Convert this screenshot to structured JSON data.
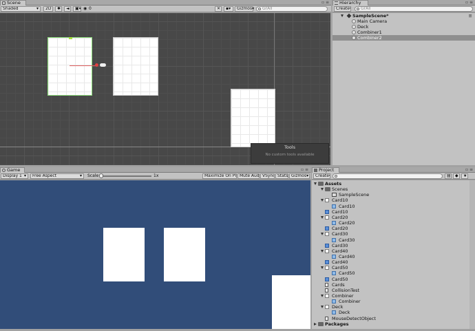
{
  "scene_panel": {
    "tab_label": "Scene",
    "toolbar": {
      "shading_mode": "Shaded",
      "mode_2d": "2D",
      "fx_count": "0",
      "gizmos_label": "Gizmos",
      "search_placeholder": "GrAll"
    },
    "tools_overlay": {
      "title": "Tools",
      "message": "No custom tools available"
    }
  },
  "hierarchy_panel": {
    "tab_label": "Hierarchy",
    "create_label": "Create",
    "search_placeholder": "GrAll",
    "scene_name": "SampleScene*",
    "items": [
      {
        "label": "Main Camera",
        "selected": false
      },
      {
        "label": "Deck",
        "selected": false
      },
      {
        "label": "Combiner1",
        "selected": false
      },
      {
        "label": "Combiner2",
        "selected": true
      }
    ]
  },
  "game_panel": {
    "tab_label": "Game",
    "display_label": "Display 1",
    "aspect_label": "Free Aspect",
    "scale_label": "Scale",
    "scale_value": "1x",
    "maximize_label": "Maximize On Play",
    "mute_label": "Mute Audio",
    "vsync_label": "VSync",
    "stats_label": "Stats",
    "gizmos_label": "Gizmos"
  },
  "project_panel": {
    "tab_label": "Project",
    "create_label": "Create",
    "items": [
      {
        "label": "Assets",
        "indent": 0,
        "icon": "folder",
        "arrow": "down",
        "bold": true
      },
      {
        "label": "Scenes",
        "indent": 1,
        "icon": "folder",
        "arrow": "down"
      },
      {
        "label": "SampleScene",
        "indent": 2,
        "icon": "scene"
      },
      {
        "label": "Card10",
        "indent": 1,
        "icon": "white",
        "arrow": "down"
      },
      {
        "label": "Card10",
        "indent": 2,
        "icon": "sub"
      },
      {
        "label": "Card10",
        "indent": 1,
        "icon": "prefab"
      },
      {
        "label": "Card20",
        "indent": 1,
        "icon": "white",
        "arrow": "down"
      },
      {
        "label": "Card20",
        "indent": 2,
        "icon": "sub"
      },
      {
        "label": "Card20",
        "indent": 1,
        "icon": "prefab"
      },
      {
        "label": "Card30",
        "indent": 1,
        "icon": "white",
        "arrow": "down"
      },
      {
        "label": "Card30",
        "indent": 2,
        "icon": "sub"
      },
      {
        "label": "Card30",
        "indent": 1,
        "icon": "prefab"
      },
      {
        "label": "Card40",
        "indent": 1,
        "icon": "white",
        "arrow": "down"
      },
      {
        "label": "Card40",
        "indent": 2,
        "icon": "sub"
      },
      {
        "label": "Card40",
        "indent": 1,
        "icon": "prefab"
      },
      {
        "label": "Card50",
        "indent": 1,
        "icon": "white",
        "arrow": "down"
      },
      {
        "label": "Card50",
        "indent": 2,
        "icon": "sub"
      },
      {
        "label": "Card50",
        "indent": 1,
        "icon": "prefab"
      },
      {
        "label": "Cards",
        "indent": 1,
        "icon": "script"
      },
      {
        "label": "CollisionTest",
        "indent": 1,
        "icon": "script"
      },
      {
        "label": "Combiner",
        "indent": 1,
        "icon": "white",
        "arrow": "down"
      },
      {
        "label": "Combiner",
        "indent": 2,
        "icon": "sub"
      },
      {
        "label": "Deck",
        "indent": 1,
        "icon": "white",
        "arrow": "down"
      },
      {
        "label": "Deck",
        "indent": 2,
        "icon": "sub"
      },
      {
        "label": "MouseDetectObject",
        "indent": 1,
        "icon": "script"
      },
      {
        "label": "Packages",
        "indent": 0,
        "icon": "folder",
        "arrow": "right",
        "bold": true
      }
    ]
  },
  "colors": {
    "scene_bg": "#484848",
    "game_bg": "#314d79",
    "selection": "#8f8f8f",
    "editor_bg": "#a2a2a2"
  }
}
